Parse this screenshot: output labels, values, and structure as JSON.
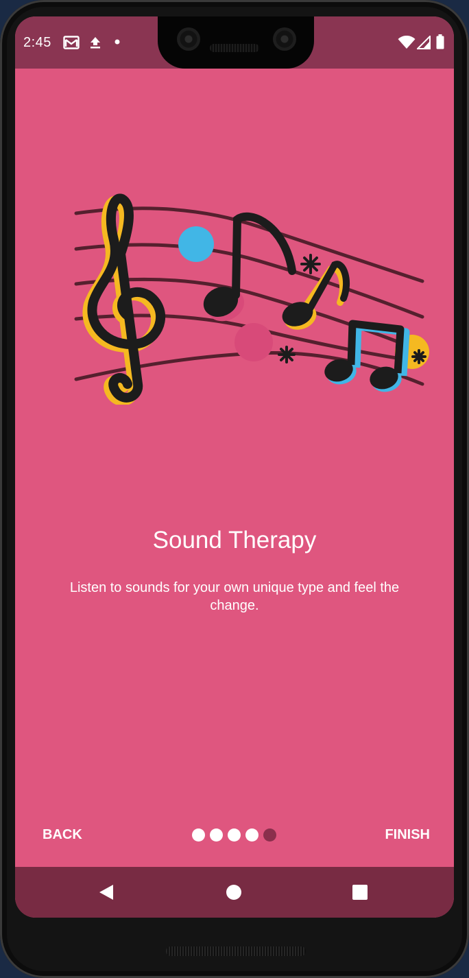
{
  "status_bar": {
    "time": "2:45",
    "left_icons": [
      "gmail-icon",
      "upload-icon",
      "notification-dot-icon"
    ],
    "right_icons": [
      "wifi-icon",
      "cellular-signal-icon",
      "battery-icon"
    ]
  },
  "onboarding": {
    "title": "Sound Therapy",
    "description": "Listen to sounds for your own unique type and feel the change.",
    "illustration": "music-notes-icon",
    "background_color": "#df567f"
  },
  "footer": {
    "back_label": "BACK",
    "finish_label": "FINISH",
    "page_indicator": {
      "total": 5,
      "current": 5
    }
  },
  "nav_bar": {
    "icons": [
      "back-triangle-icon",
      "home-circle-icon",
      "recents-square-icon"
    ]
  },
  "colors": {
    "accent_dark": "#8a3552",
    "nav_bar": "#782b43",
    "note_yellow": "#f5b921",
    "note_blue": "#41b6e6",
    "note_black": "#1c1c1c"
  }
}
